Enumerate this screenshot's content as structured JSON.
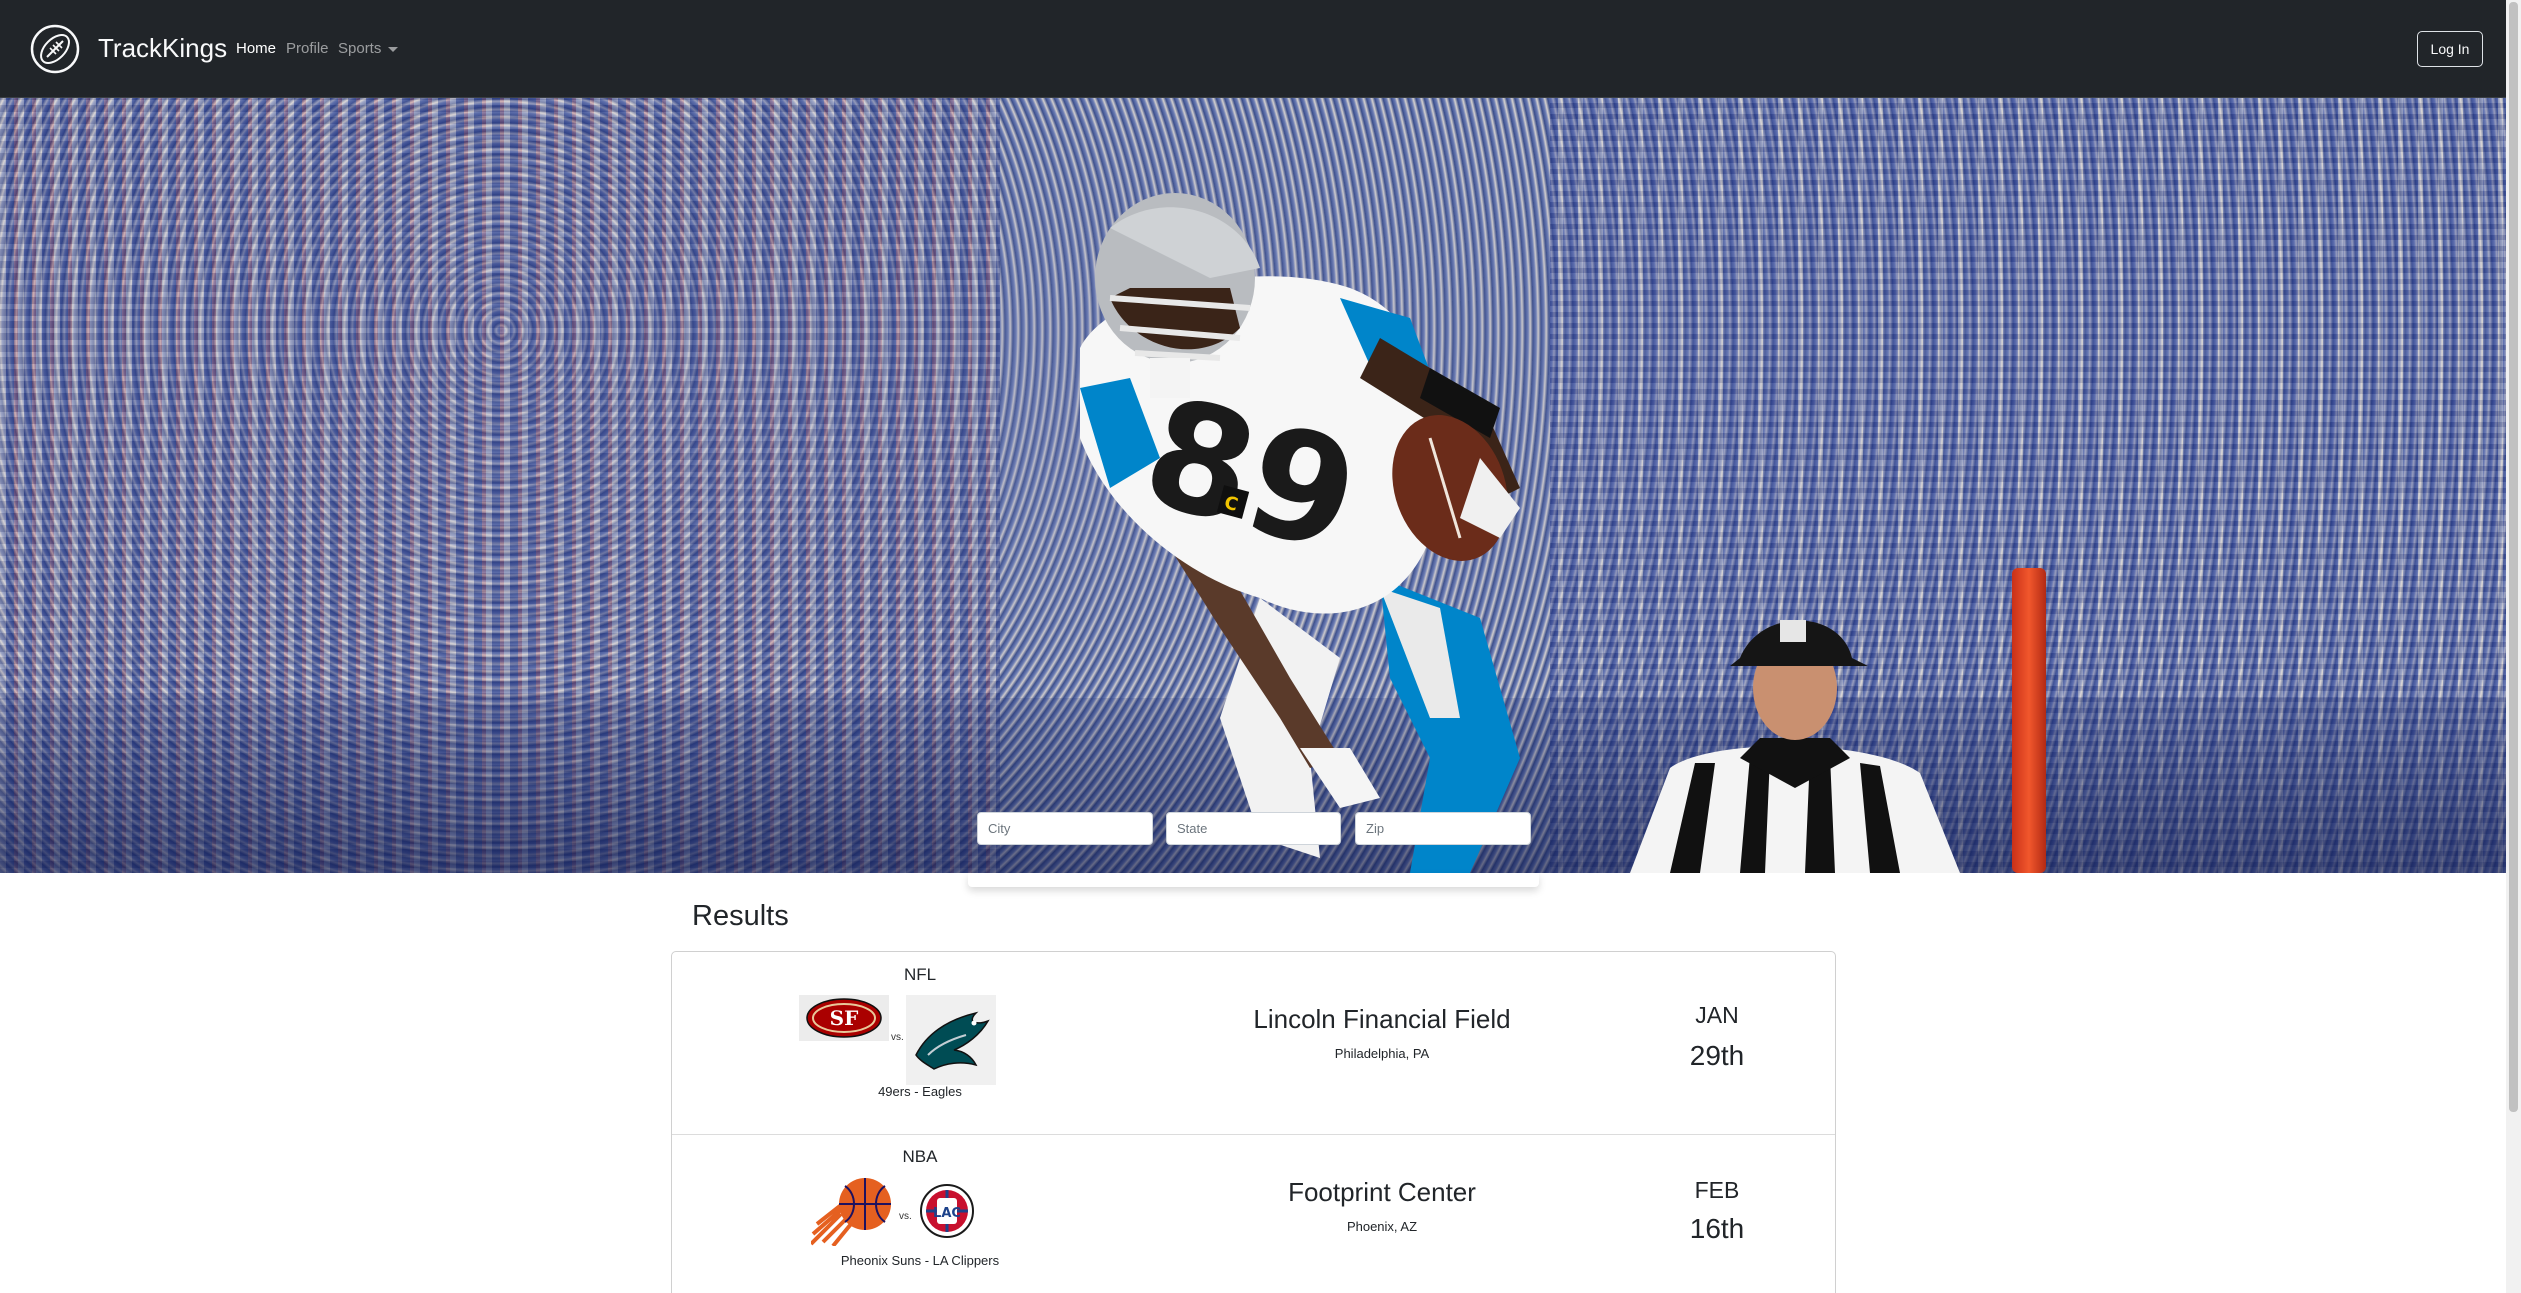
{
  "navbar": {
    "brand": "TrackKings",
    "logo_icon": "football-icon",
    "links": [
      {
        "label": "Home",
        "active": true
      },
      {
        "label": "Profile",
        "active": false
      },
      {
        "label": "Sports",
        "active": false,
        "dropdown": true
      }
    ],
    "login_label": "Log In"
  },
  "search": {
    "city_placeholder": "City",
    "state_placeholder": "State",
    "zip_placeholder": "Zip"
  },
  "results": {
    "title": "Results",
    "games": [
      {
        "league": "NFL",
        "vs": "vs.",
        "teams": "49ers - Eagles",
        "home_logo": "49ers-logo",
        "away_logo": "eagles-logo",
        "venue": "Lincoln Financial Field",
        "city": "Philadelphia, PA",
        "month": "JAN",
        "day": "29th"
      },
      {
        "league": "NBA",
        "vs": "vs.",
        "teams": "Pheonix Suns - LA Clippers",
        "home_logo": "suns-logo",
        "away_logo": "clippers-logo",
        "venue": "Footprint Center",
        "city": "Phoenix, AZ",
        "month": "FEB",
        "day": "16th"
      }
    ]
  },
  "colors": {
    "navbar_bg": "#212529",
    "niners_red": "#AA0000",
    "eagles_green": "#004C54",
    "suns_orange": "#E56020",
    "clippers_blue": "#1D428A",
    "clippers_red": "#C8102E",
    "panthers_blue": "#0085CA"
  }
}
